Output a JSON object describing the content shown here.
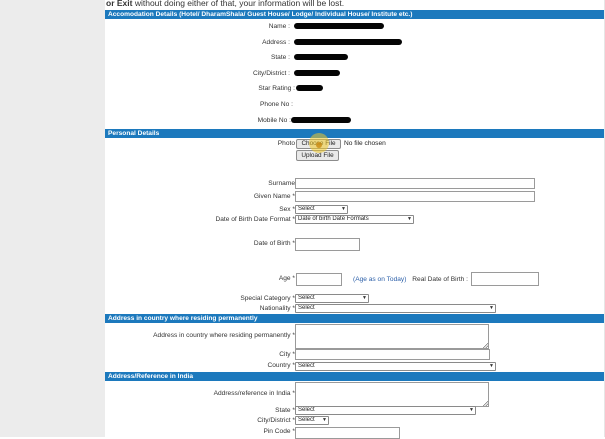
{
  "colors": {
    "section_bar": "#1c79bd",
    "redaction": "#050505"
  },
  "top_note": {
    "bold": "or Exit",
    "rest": "without doing either of that, your information will be lost."
  },
  "accommodation": {
    "title": "Accomodation Details (Hotel/ DharamShala/ Guest House/ Lodge/ Individual House/ Institute etc.)",
    "name_label": "Name :",
    "address_label": "Address :",
    "state_label": "State :",
    "city_label": "City/District :",
    "star_label": "Star Rating :",
    "phone_label": "Phone No :",
    "mobile_label": "Mobile No :"
  },
  "personal": {
    "title": "Personal Details",
    "photo_label": "Photo",
    "choose_file": "Choose File",
    "no_file": "No file chosen",
    "upload": "Upload File",
    "surname_label": "Surname",
    "given_name_label": "Given Name",
    "sex_label": "Sex",
    "sex_value": "Select",
    "dob_format_label": "Date of Birth Date Format",
    "dob_format_value": "Date of birth Date Formats",
    "dob_label": "Date of Birth",
    "age_label": "Age",
    "age_link": "(Age as on Today)",
    "real_dob_label": "Real Date of Birth :",
    "special_category_label": "Special Category",
    "special_category_value": "Select",
    "nationality_label": "Nationality",
    "nationality_value": "Select",
    "required_mark": "*"
  },
  "perm_address": {
    "title": "Address in country where residing permanently",
    "address_label": "Address in country where residing permanently",
    "city_label": "City",
    "country_label": "Country",
    "country_value": "Select"
  },
  "india_address": {
    "title": "Address/Reference in India",
    "address_label": "Address/reference in India",
    "state_label": "State",
    "state_value": "Select",
    "city_label": "City/District",
    "city_value": "Select",
    "pin_label": "Pin Code"
  }
}
